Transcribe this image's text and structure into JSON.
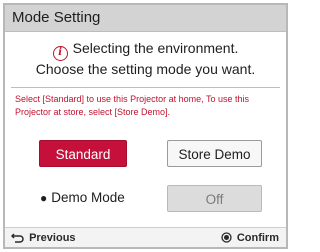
{
  "dialog": {
    "title": "Mode Setting",
    "message_line1": "Selecting the environment.",
    "message_line2": "Choose the setting mode you want.",
    "help_text": "Select [Standard] to use this Projector at home, To use this Projector at store, select [Store Demo]."
  },
  "icons": {
    "info": "info-circle-icon",
    "back": "return-arrow-icon",
    "confirm": "ok-circle-icon"
  },
  "mode_buttons": {
    "standard": "Standard",
    "store_demo": "Store Demo",
    "selected": "Standard"
  },
  "demo_mode": {
    "label": "Demo Mode",
    "value": "Off"
  },
  "footer": {
    "previous": "Previous",
    "confirm": "Confirm"
  },
  "colors": {
    "accent": "#c4103a",
    "title_bar": "#d3d3d3",
    "help_text": "#c0132e",
    "disabled": "#dcdcdc"
  }
}
